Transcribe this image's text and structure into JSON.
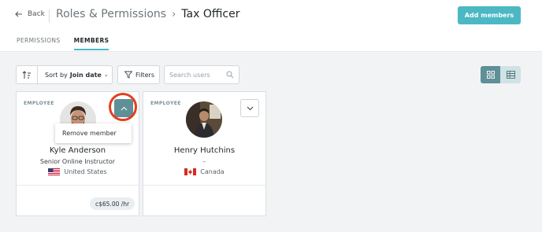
{
  "header": {
    "back_label": "Back",
    "breadcrumb_parent": "Roles & Permissions",
    "breadcrumb_separator": "›",
    "breadcrumb_current": "Tax Officer",
    "add_button_label": "Add members"
  },
  "tabs": [
    {
      "label": "PERMISSIONS",
      "active": false
    },
    {
      "label": "MEMBERS",
      "active": true
    }
  ],
  "toolbar": {
    "sort_prefix": "Sort by",
    "sort_value": "Join date",
    "filters_label": "Filters",
    "search_placeholder": "Search users",
    "view_mode": "grid"
  },
  "members": [
    {
      "role": "EMPLOYEE",
      "name": "Kyle Anderson",
      "title": "Senior Online Instructor",
      "country": "United States",
      "rate": "c$65.00 /hr",
      "menu_open": true
    },
    {
      "role": "EMPLOYEE",
      "name": "Henry Hutchins",
      "title": "-",
      "country": "Canada",
      "rate": "",
      "menu_open": false
    }
  ],
  "dropdown": {
    "remove_label": "Remove member"
  },
  "colors": {
    "accent": "#4bb8c4",
    "toggle_active": "#5f8f97",
    "highlight_ring": "#e53d1e"
  }
}
